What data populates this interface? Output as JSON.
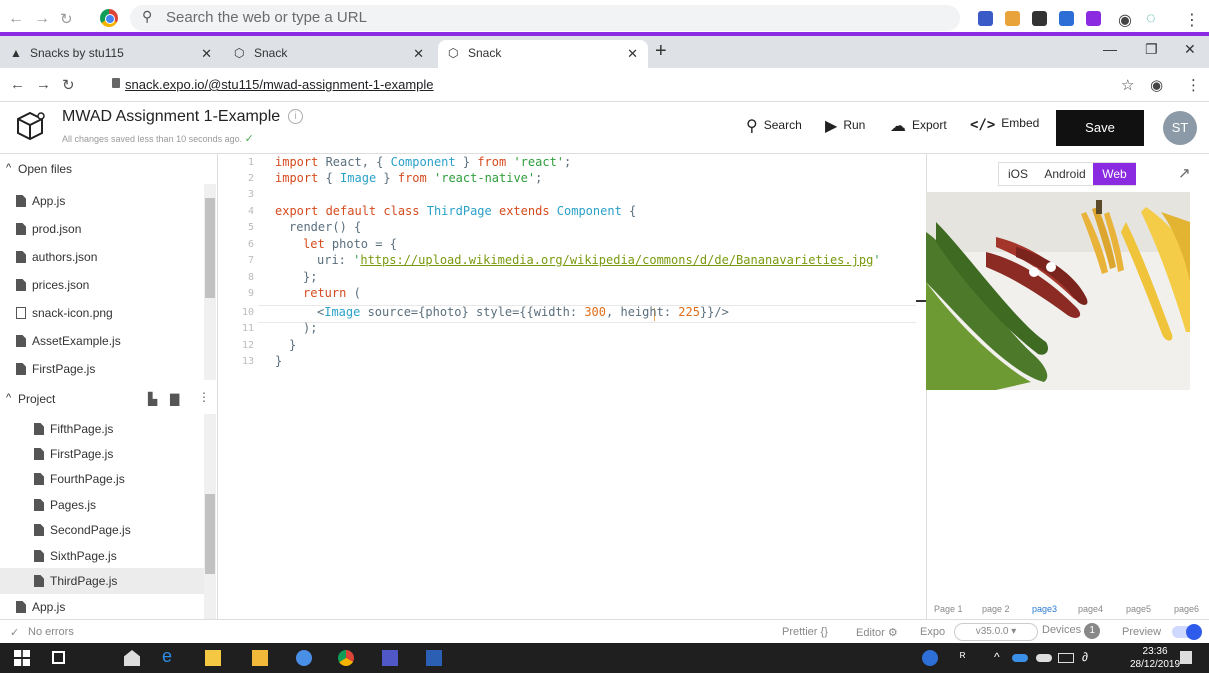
{
  "browser": {
    "omnibox_placeholder": "Search the web or type a URL",
    "tabs": [
      {
        "label": "Snacks by stu115"
      },
      {
        "label": "Snack"
      },
      {
        "label": "Snack"
      }
    ],
    "url": "snack.expo.io/@stu115/mwad-assignment-1-example"
  },
  "header": {
    "title": "MWAD Assignment 1-Example",
    "saved_status": "All changes saved less than 10 seconds ago.",
    "search_label": "Search",
    "run_label": "Run",
    "export_label": "Export",
    "embed_label": "Embed",
    "save_label": "Save",
    "avatar_initials": "ST"
  },
  "sidebar": {
    "open_files_label": "Open files",
    "open_files": [
      "App.js",
      "prod.json",
      "authors.json",
      "prices.json",
      "snack-icon.png",
      "AssetExample.js",
      "FirstPage.js"
    ],
    "project_label": "Project",
    "project_files": [
      "FifthPage.js",
      "FirstPage.js",
      "FourthPage.js",
      "Pages.js",
      "SecondPage.js",
      "SixthPage.js",
      "ThirdPage.js",
      "App.js"
    ],
    "selected_file": "ThirdPage.js"
  },
  "editor": {
    "line_numbers": [
      "1",
      "2",
      "3",
      "4",
      "5",
      "6",
      "7",
      "8",
      "9",
      "10",
      "11",
      "12",
      "13"
    ],
    "l1": {
      "kw": "import",
      "a": " React, { ",
      "cls": "Component",
      "b": " } ",
      "kw2": "from",
      "str": " 'react'",
      "end": ";"
    },
    "l2": {
      "kw": "import",
      "a": " { ",
      "cls": "Image",
      "b": " } ",
      "kw2": "from",
      "str": " 'react-native'",
      "end": ";"
    },
    "l4": {
      "kw": "export default class",
      "cls": " ThirdPage ",
      "kw2": "extends",
      "cls2": " Component",
      "end": " {"
    },
    "l5": "render() {",
    "l6": {
      "kw": "let",
      "rest": " photo = {"
    },
    "l7": {
      "key": "uri: ",
      "q1": "'",
      "url": "https://upload.wikimedia.org/wikipedia/commons/d/de/Bananavarieties.jpg",
      "q2": "'"
    },
    "l8": "};",
    "l9": {
      "kw": "return",
      "rest": " ("
    },
    "l10": {
      "a": "<",
      "tag": "Image",
      "b": " source={photo} style={{width: ",
      "n1": "300",
      "c": ", height: ",
      "n2": "225",
      "d": "}}/>"
    },
    "l11": ");",
    "l12": "}",
    "l13": "}"
  },
  "preview": {
    "platforms": [
      "iOS",
      "Android",
      "Web"
    ],
    "active_platform": "Web",
    "pages": [
      "Page 1",
      "page 2",
      "page3",
      "page4",
      "page5",
      "page6"
    ],
    "active_page": "page3"
  },
  "status": {
    "errors": "No errors",
    "prettier": "Prettier",
    "editor": "Editor",
    "expo": "Expo",
    "expo_version": "v35.0.0",
    "devices": "Devices",
    "devices_count": "1",
    "preview": "Preview"
  },
  "taskbar": {
    "time": "23:36",
    "date": "28/12/2019"
  },
  "colors": {
    "accent": "#8a2be2",
    "save_button": "#111111"
  }
}
